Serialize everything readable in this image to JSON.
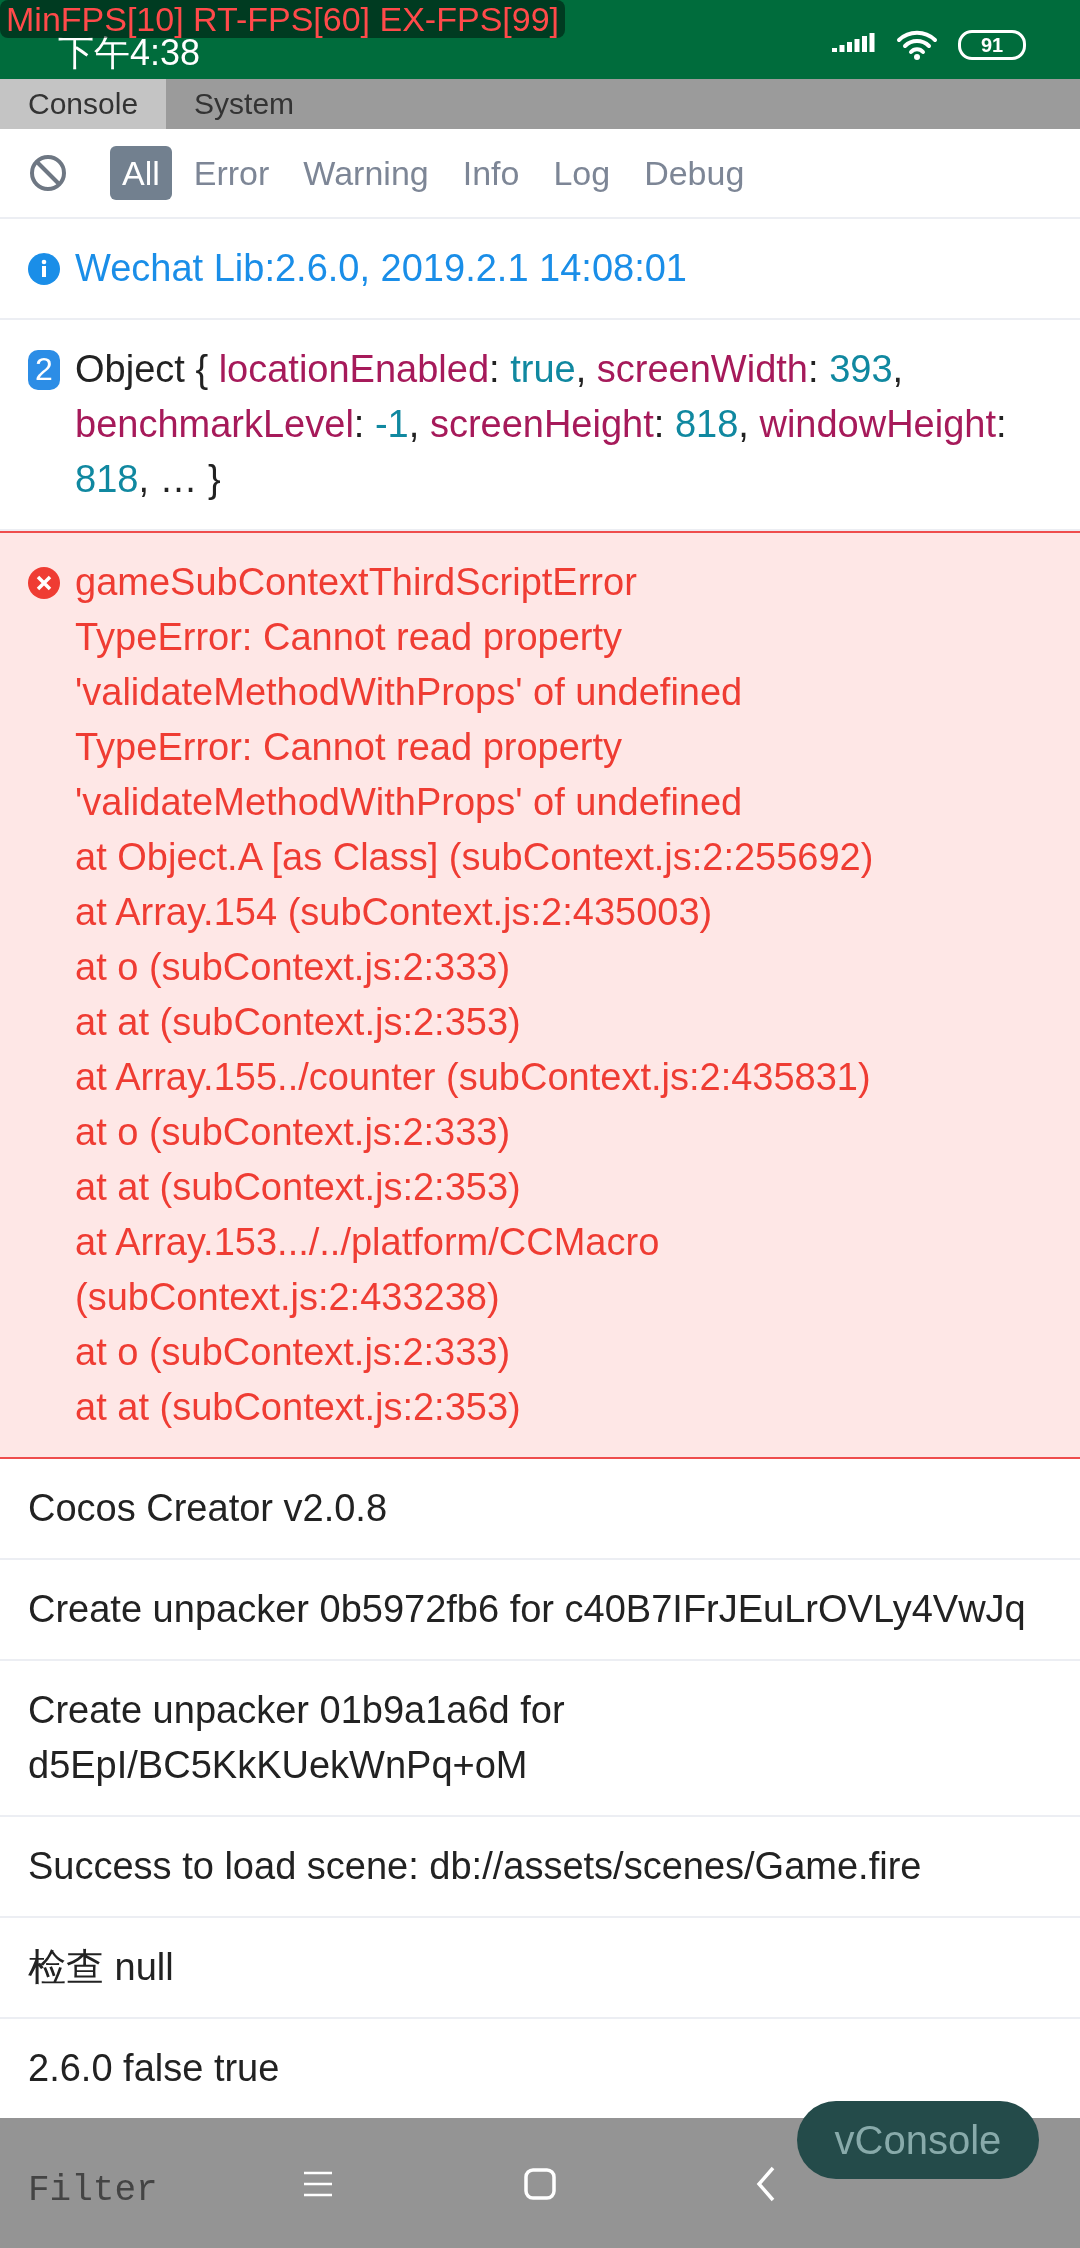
{
  "fps_overlay": "MinFPS[10] RT-FPS[60] EX-FPS[99]",
  "status_bar": {
    "time": "下午4:38",
    "battery": "91"
  },
  "panel_tabs": [
    {
      "label": "Console",
      "selected": true
    },
    {
      "label": "System",
      "selected": false
    }
  ],
  "filter_tabs": [
    {
      "label": "All",
      "selected": true
    },
    {
      "label": "Error",
      "selected": false
    },
    {
      "label": "Warning",
      "selected": false
    },
    {
      "label": "Info",
      "selected": false
    },
    {
      "label": "Log",
      "selected": false
    },
    {
      "label": "Debug",
      "selected": false
    }
  ],
  "logs": [
    {
      "kind": "info",
      "text": "Wechat Lib:2.6.0, 2019.2.1 14:08:01"
    },
    {
      "kind": "object",
      "count": "2",
      "parts": [
        {
          "kind": "plain",
          "text": "Object { "
        },
        {
          "kind": "key",
          "text": "locationEnabled"
        },
        {
          "kind": "plain",
          "text": ": "
        },
        {
          "kind": "value",
          "text": "true"
        },
        {
          "kind": "plain",
          "text": ", "
        },
        {
          "kind": "key",
          "text": "screenWidth"
        },
        {
          "kind": "plain",
          "text": ": "
        },
        {
          "kind": "value",
          "text": "393"
        },
        {
          "kind": "plain",
          "text": ", "
        },
        {
          "kind": "key",
          "text": "benchmarkLevel"
        },
        {
          "kind": "plain",
          "text": ": "
        },
        {
          "kind": "value",
          "text": "-1"
        },
        {
          "kind": "plain",
          "text": ", "
        },
        {
          "kind": "key",
          "text": "screenHeight"
        },
        {
          "kind": "plain",
          "text": ": "
        },
        {
          "kind": "value",
          "text": "818"
        },
        {
          "kind": "plain",
          "text": ", "
        },
        {
          "kind": "key",
          "text": "windowHeight"
        },
        {
          "kind": "plain",
          "text": ": "
        },
        {
          "kind": "value",
          "text": "818"
        },
        {
          "kind": "plain",
          "text": ", … }"
        }
      ]
    },
    {
      "kind": "error",
      "lines": [
        "gameSubContextThirdScriptError",
        "TypeError: Cannot read property 'validateMethodWithProps' of undefined",
        "TypeError: Cannot read property 'validateMethodWithProps' of undefined",
        "at Object.A [as Class] (subContext.js:2:255692)",
        "at Array.154 (subContext.js:2:435003)",
        "at o (subContext.js:2:333)",
        "at at (subContext.js:2:353)",
        "at Array.155../counter (subContext.js:2:435831)",
        "at o (subContext.js:2:333)",
        "at at (subContext.js:2:353)",
        "at Array.153.../../platform/CCMacro (subContext.js:2:433238)",
        "at o (subContext.js:2:333)",
        "at at (subContext.js:2:353)"
      ]
    },
    {
      "kind": "log",
      "text": "Cocos Creator v2.0.8"
    },
    {
      "kind": "log",
      "text": "Create unpacker 0b5972fb6 for c40B7IFrJEuLrOVLy4VwJq"
    },
    {
      "kind": "log",
      "text": "Create unpacker 01b9a1a6d for d5EpI/BC5KkKUekWnPq+oM"
    },
    {
      "kind": "log",
      "text": "Success to load scene: db://assets/scenes/Game.fire"
    },
    {
      "kind": "log",
      "text": "检查 null"
    },
    {
      "kind": "log",
      "text": "2.6.0 false true"
    }
  ],
  "filter_field": {
    "placeholder": "Filter"
  },
  "vconsole_button": "vConsole"
}
